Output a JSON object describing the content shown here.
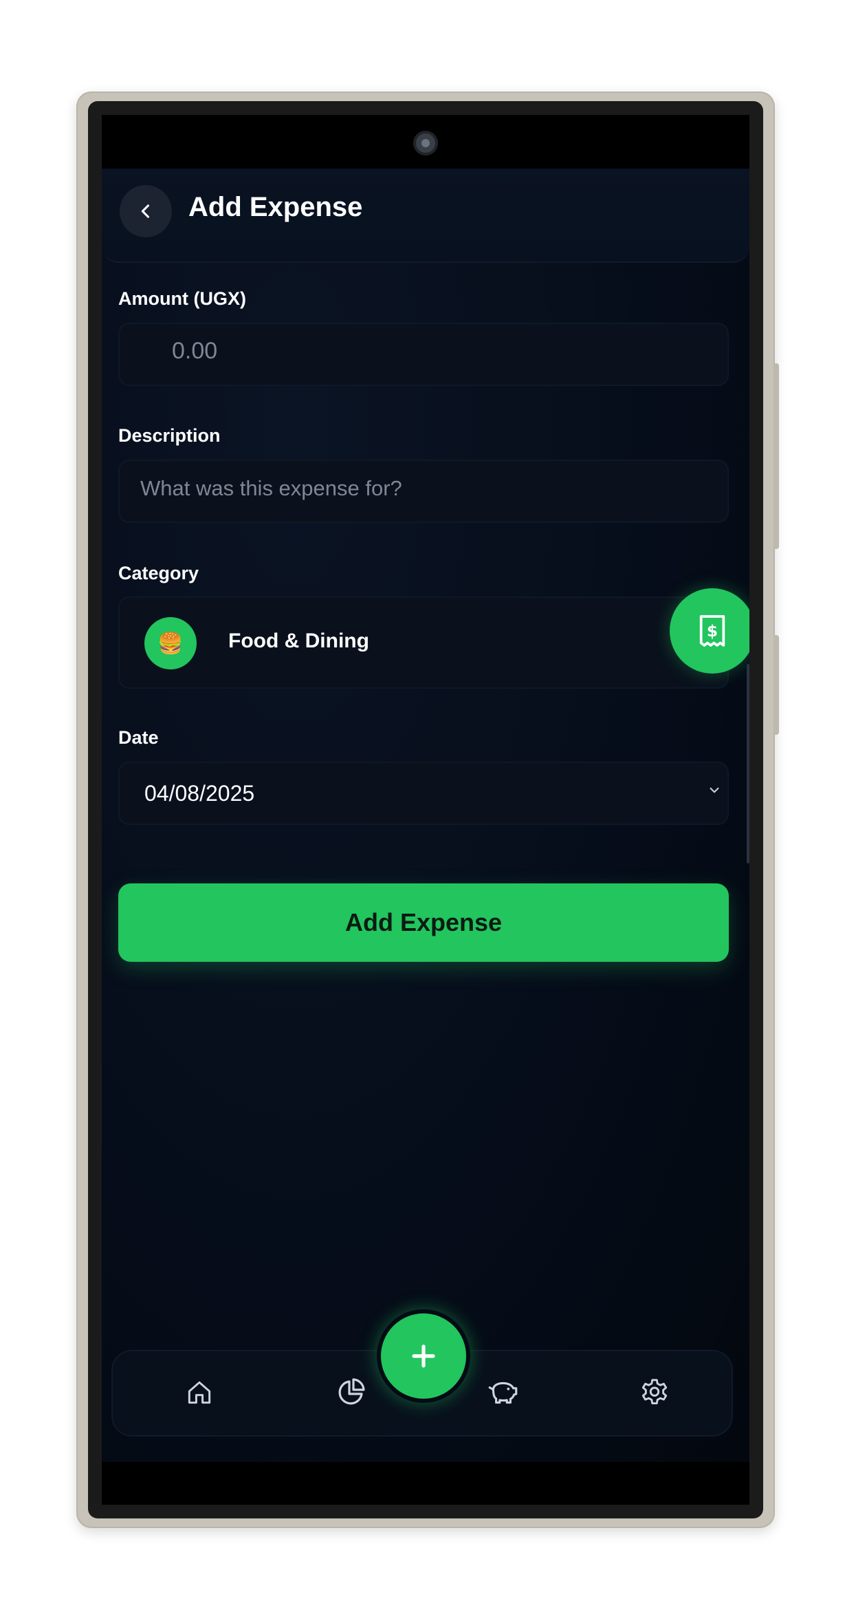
{
  "header": {
    "title": "Add Expense"
  },
  "form": {
    "amount_label": "Amount (UGX)",
    "amount_placeholder": "0.00",
    "description_label": "Description",
    "description_placeholder": "What was this expense for?",
    "category_label": "Category",
    "category_value": "Food & Dining",
    "category_icon": "🍔",
    "date_label": "Date",
    "date_value": "04/08/2025",
    "submit_label": "Add Expense"
  },
  "nav": {
    "items": [
      {
        "icon": "home-icon"
      },
      {
        "icon": "pie-chart-icon"
      },
      {
        "icon": "piggy-bank-icon"
      },
      {
        "icon": "settings-icon"
      }
    ],
    "fab_icon": "plus-icon"
  },
  "colors": {
    "accent": "#22c55e",
    "background": "#060d1a",
    "field": "#0a111c",
    "text": "#ffffff",
    "placeholder": "#7f8794"
  }
}
